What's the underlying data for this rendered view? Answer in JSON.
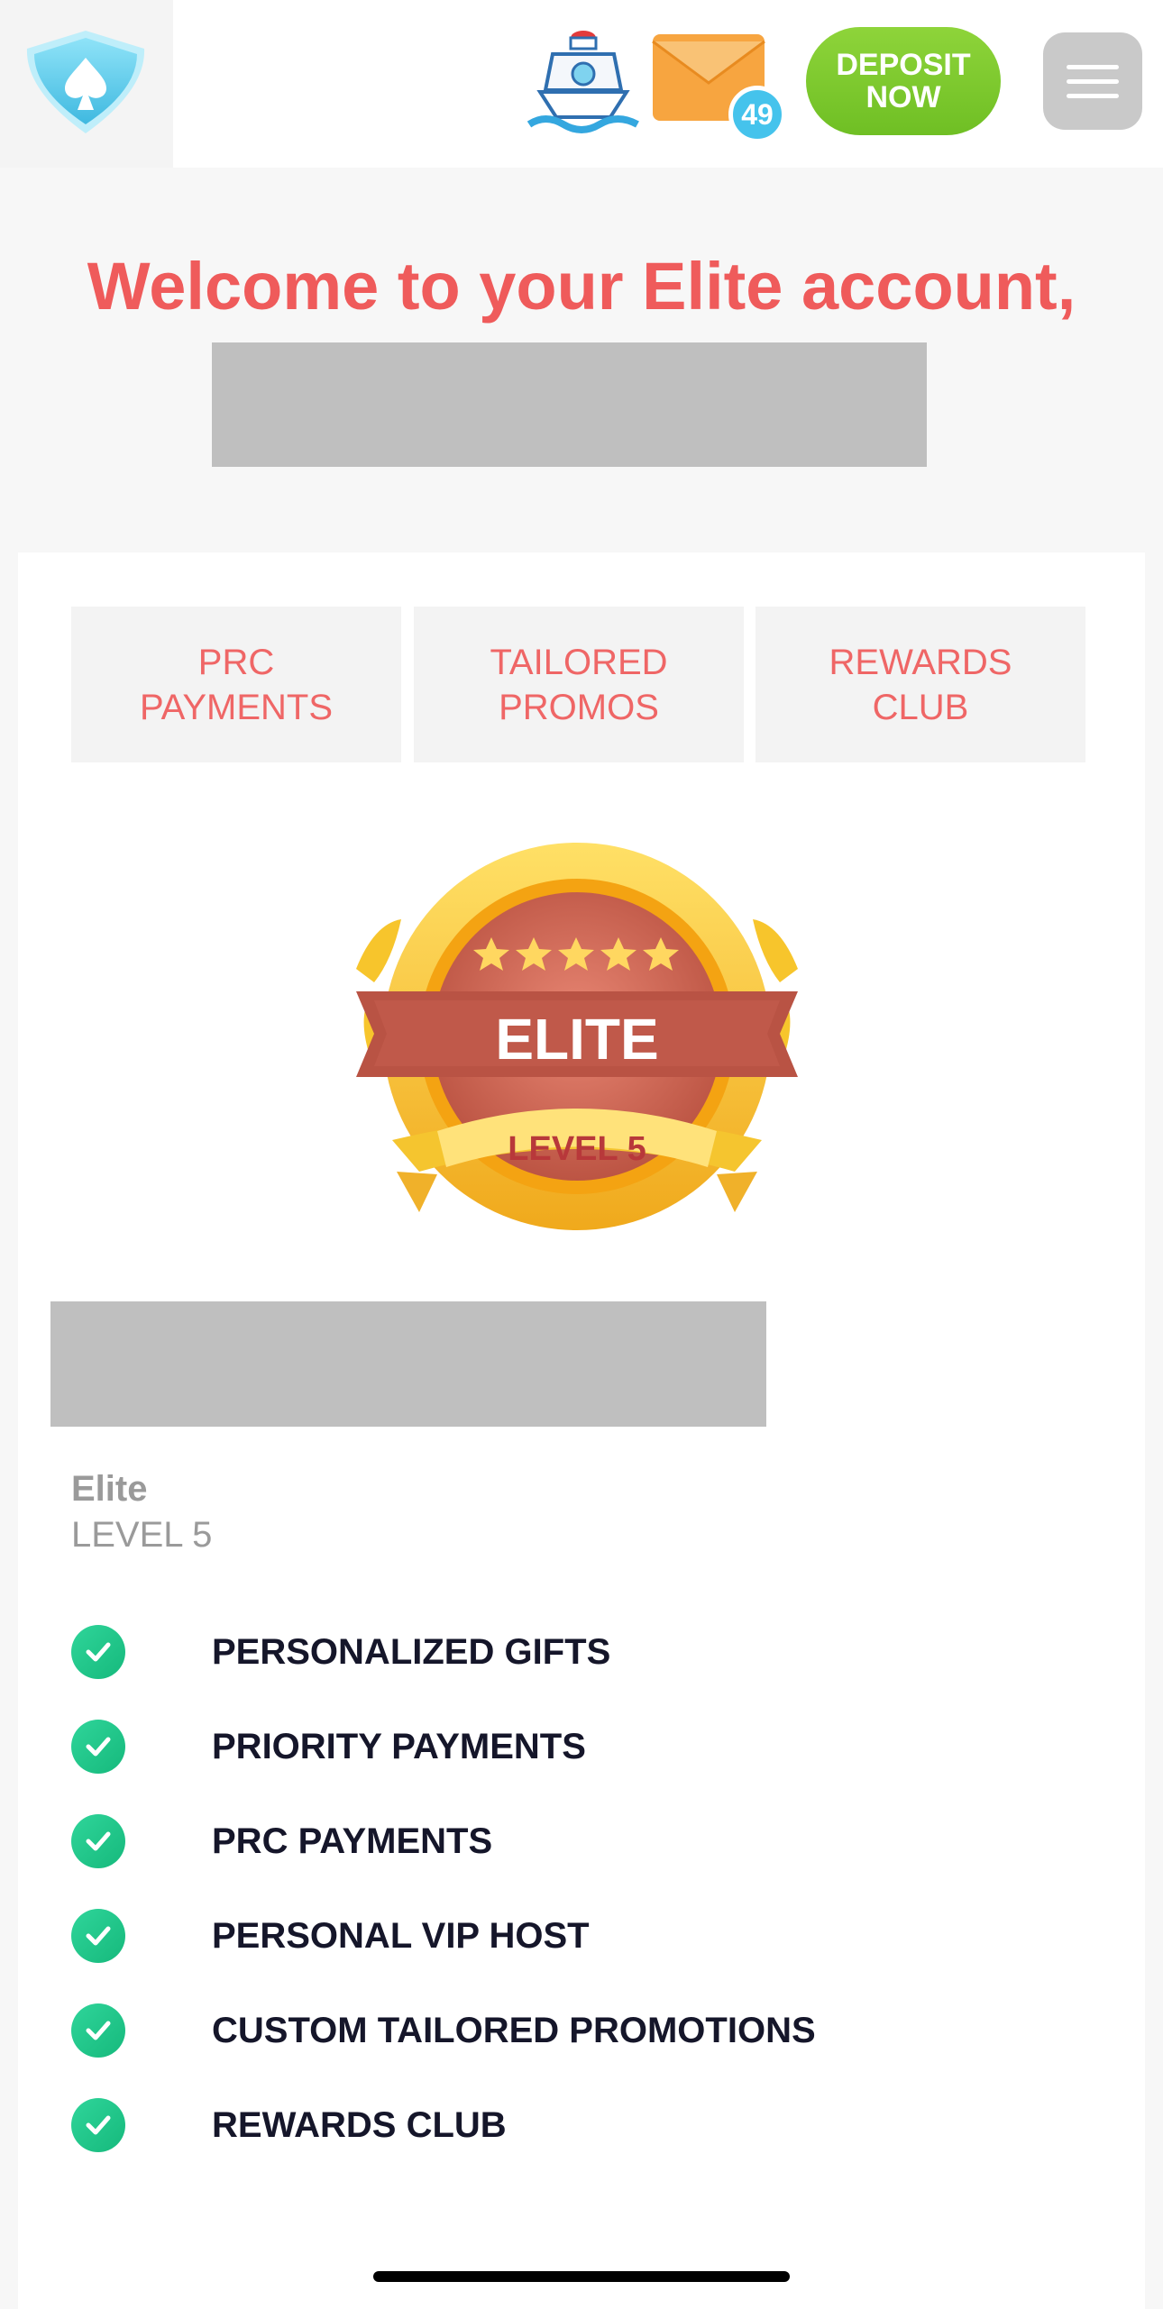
{
  "header": {
    "deposit_label": "DEPOSIT\nNOW",
    "mail_count": "49",
    "icons": [
      "spade-shield-logo",
      "ship-icon",
      "mail-icon",
      "menu-icon"
    ]
  },
  "welcome": {
    "title": "Welcome to your Elite account,"
  },
  "tabs": [
    {
      "label": "PRC\nPAYMENTS"
    },
    {
      "label": "TAILORED\nPROMOS"
    },
    {
      "label": "REWARDS\nCLUB"
    }
  ],
  "badge": {
    "title": "ELITE",
    "level": "LEVEL 5",
    "stars": 5
  },
  "tier": {
    "name": "Elite",
    "level": "LEVEL 5"
  },
  "benefits": [
    "PERSONALIZED GIFTS",
    "PRIORITY PAYMENTS",
    "PRC PAYMENTS",
    "PERSONAL VIP HOST",
    "CUSTOM TAILORED PROMOTIONS",
    "REWARDS CLUB"
  ],
  "colors": {
    "accent_red": "#ef5b5b",
    "deposit_green": "#7ac82d",
    "check_green": "#1cc686",
    "badge_gold": "#f6c530",
    "ribbon_red": "#b95344"
  }
}
